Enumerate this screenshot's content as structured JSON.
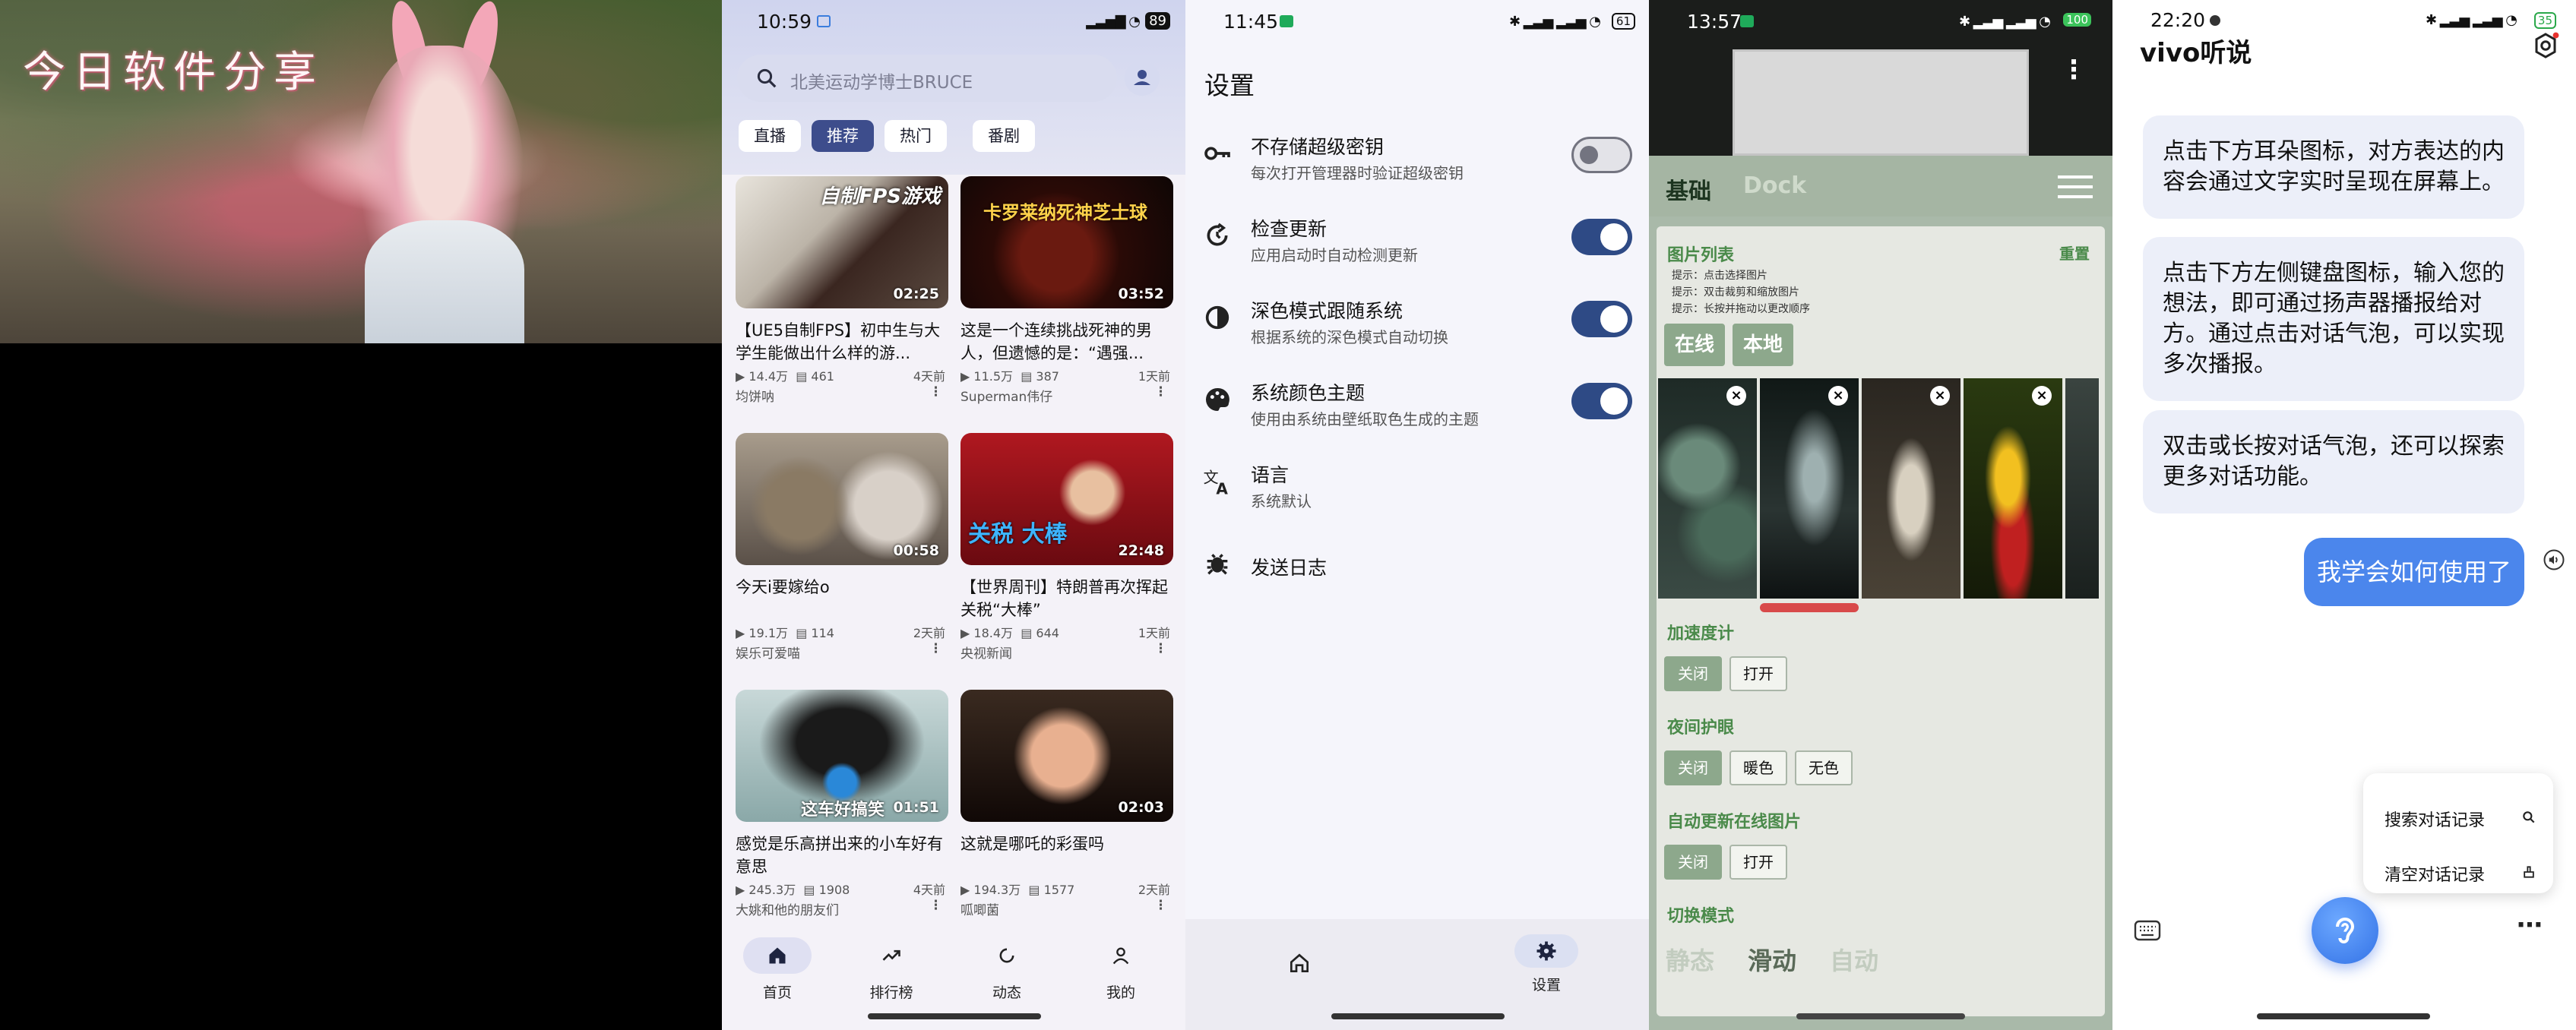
{
  "cover": {
    "title": "今日软件分享"
  },
  "video_app": {
    "status": {
      "time": "10:59",
      "battery": "89"
    },
    "search_placeholder": "北美运动学博士BRUCE",
    "chips": [
      "直播",
      "推荐",
      "热门",
      "番剧"
    ],
    "selected_chip": "推荐",
    "videos": [
      {
        "overlay": "自制FPS游戏",
        "duration": "02:25",
        "title": "【UE5自制FPS】初中生与大学生能做出什么样的游...",
        "views": "14.4万",
        "danmaku": "461",
        "age": "4天前",
        "author": "均饼呐"
      },
      {
        "overlay": "卡罗莱纳死神芝士球",
        "duration": "03:52",
        "title": "这是一个连续挑战死神的男人，但遗憾的是：“遇强...",
        "views": "11.5万",
        "danmaku": "387",
        "age": "1天前",
        "author": "Superman伟仔"
      },
      {
        "overlay": "",
        "duration": "00:58",
        "title": "今天i要嫁给o",
        "views": "19.1万",
        "danmaku": "114",
        "age": "2天前",
        "author": "娱乐可爱喵"
      },
      {
        "overlay": "关税 大棒",
        "duration": "22:48",
        "title": "【世界周刊】特朗普再次挥起关税“大棒”",
        "views": "18.4万",
        "danmaku": "644",
        "age": "1天前",
        "author": "央视新闻"
      },
      {
        "overlay": "这车好搞笑",
        "duration": "01:51",
        "title": "感觉是乐高拼出来的小车好有意思",
        "views": "245.3万",
        "danmaku": "1908",
        "age": "4天前",
        "author": "大姚和他的朋友们"
      },
      {
        "overlay": "",
        "duration": "02:03",
        "title": "这就是哪吒的彩蛋吗",
        "views": "194.3万",
        "danmaku": "1577",
        "age": "2天前",
        "author": "呱唧菌"
      }
    ],
    "nav": [
      "首页",
      "排行榜",
      "动态",
      "我的"
    ]
  },
  "settings_app": {
    "status": {
      "time": "11:45",
      "battery": "61"
    },
    "title": "设置",
    "rows": [
      {
        "title": "不存储超级密钥",
        "subtitle": "每次打开管理器时验证超级密钥",
        "toggle": false,
        "icon": "key-icon"
      },
      {
        "title": "检查更新",
        "subtitle": "应用启动时自动检测更新",
        "toggle": true,
        "icon": "refresh-icon"
      },
      {
        "title": "深色模式跟随系统",
        "subtitle": "根据系统的深色模式自动切换",
        "toggle": true,
        "icon": "contrast-icon"
      },
      {
        "title": "系统颜色主题",
        "subtitle": "使用由系统由壁纸取色生成的主题",
        "toggle": true,
        "icon": "palette-icon"
      },
      {
        "title": "语言",
        "subtitle": "系统默认",
        "icon": "translate-icon"
      },
      {
        "title": "发送日志",
        "subtitle": "",
        "icon": "bug-icon"
      }
    ],
    "nav": [
      "设置"
    ]
  },
  "gallery_app": {
    "status": {
      "time": "13:57",
      "battery": "100"
    },
    "tabs": [
      "基础",
      "Dock"
    ],
    "image_list": {
      "title": "图片列表",
      "reset": "重置",
      "hints": [
        "提示：点击选择图片",
        "提示：双击裁剪和缩放图片",
        "提示：长按并拖动以更改顺序"
      ],
      "sources": [
        "在线",
        "本地"
      ]
    },
    "accelerometer": {
      "title": "加速度计",
      "options": [
        "关闭",
        "打开"
      ]
    },
    "night": {
      "title": "夜间护眼",
      "options": [
        "关闭",
        "暖色",
        "无色"
      ]
    },
    "auto_update": {
      "title": "自动更新在线图片",
      "options": [
        "关闭",
        "打开"
      ]
    },
    "switch_mode": {
      "title": "切换模式",
      "options": [
        "静态",
        "滑动",
        "自动"
      ]
    }
  },
  "vivo_app": {
    "status": {
      "time": "22:20",
      "battery": "35"
    },
    "brand": "vivo听说",
    "bubbles": [
      "点击下方耳朵图标，对方表达的内容会通过文字实时呈现在屏幕上。",
      "点击下方左侧键盘图标，输入您的想法，即可通过扬声器播报给对方。通过点击对话气泡，可以实现多次播报。",
      "双击或长按对话气泡，还可以探索更多对话功能。"
    ],
    "my_message": "我学会如何使用了",
    "menu": [
      "搜索对话记录",
      "清空对话记录"
    ]
  }
}
